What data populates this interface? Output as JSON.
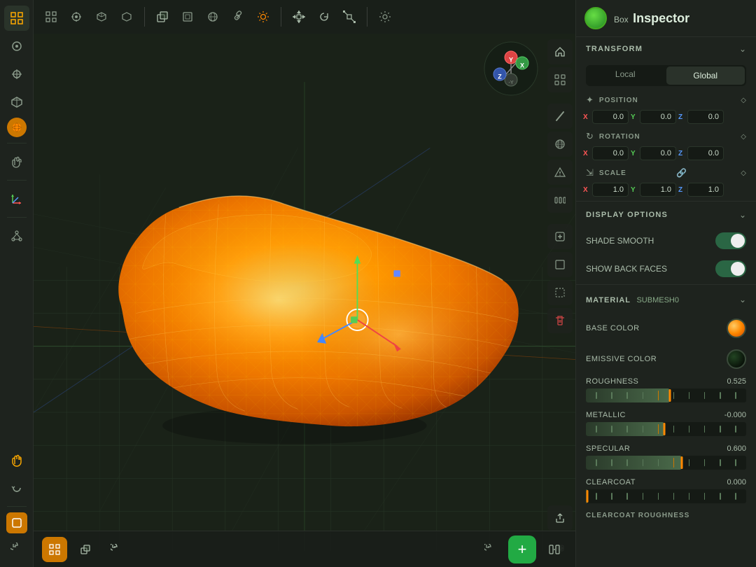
{
  "inspector": {
    "title": "Inspector",
    "subtitle": "Box",
    "avatar_color": "#44cc22"
  },
  "toolbar": {
    "top_icons": [
      "⊞",
      "✦",
      "◎",
      "▣",
      "●"
    ],
    "view_icons": [
      "⬛",
      "⬜",
      "⬡",
      "⊕",
      "⊙"
    ],
    "snap_icons": [
      "⊕",
      "◎",
      "△",
      "↕"
    ],
    "left_icons": [
      "⊞",
      "✦",
      "◎",
      "▣",
      "↕",
      "⊕",
      "☆"
    ],
    "bottom_icons": [
      "☰",
      "⬜",
      "↺"
    ]
  },
  "transform": {
    "section_label": "TRANSFORM",
    "local_label": "Local",
    "global_label": "Global",
    "position_label": "POSITION",
    "rotation_label": "ROTATION",
    "scale_label": "SCALE",
    "position": {
      "x": "0.0",
      "y": "0.0",
      "z": "0.0"
    },
    "rotation": {
      "x": "0.0",
      "y": "0.0",
      "z": "0.0"
    },
    "scale": {
      "x": "1.0",
      "y": "1.0",
      "z": "1.0"
    }
  },
  "display_options": {
    "section_label": "DISPLAY OPTIONS",
    "shade_smooth_label": "SHADE SMOOTH",
    "shade_smooth_on": true,
    "show_back_faces_label": "SHOW BACK FACES",
    "show_back_faces_on": true
  },
  "material": {
    "section_label": "MATERIAL",
    "submesh_label": "SUBMESH0",
    "base_color_label": "BASE COLOR",
    "base_color": "#ff8800",
    "emissive_color_label": "EMISSIVE COLOR",
    "emissive_color": "#000000",
    "roughness_label": "ROUGHNESS",
    "roughness_value": "0.525",
    "roughness_pct": 52.5,
    "metallic_label": "METALLIC",
    "metallic_value": "-0.000",
    "metallic_pct": 49,
    "specular_label": "SPECULAR",
    "specular_value": "0.600",
    "specular_pct": 60,
    "clearcoat_label": "CLEARCOAT",
    "clearcoat_value": "0.000",
    "clearcoat_pct": 0,
    "clearcoat_roughness_label": "CLEARCOAT ROUGHNESS"
  },
  "bottom_bar": {
    "add_icon": "+",
    "undo_icon": "↺",
    "grid_icon": "⊞"
  },
  "gizmo": {
    "x_label": "X",
    "y_label": "Y",
    "z_label": "Z"
  }
}
